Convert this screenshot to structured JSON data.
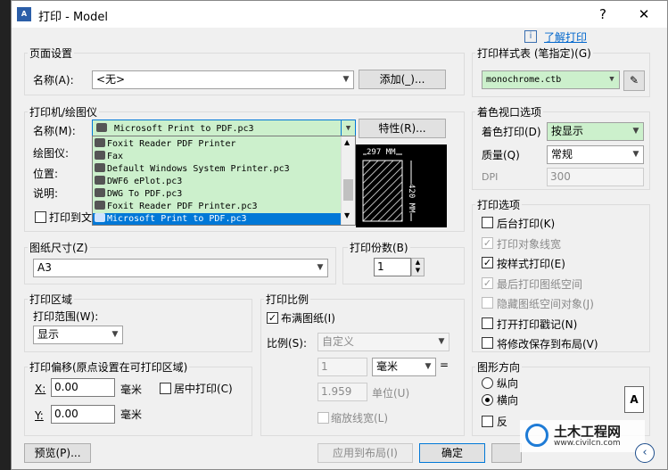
{
  "window": {
    "title": "打印 - Model",
    "help_btn": "?",
    "close_btn": "✕",
    "info_link": "了解打印"
  },
  "page_setup": {
    "group": "页面设置",
    "name_label": "名称(A):",
    "name_value": "<无>",
    "add_btn": "添加(_)..."
  },
  "printer": {
    "group": "打印机/绘图仪",
    "name_label": "名称(M):",
    "selected": "Microsoft Print to PDF.pc3",
    "props_btn": "特性(R)...",
    "plotter_label": "绘图仪:",
    "location_label": "位置:",
    "desc_label": "说明:",
    "print_to_file": "打印到文",
    "list": [
      "Foxit Reader PDF Printer",
      "Fax",
      "Default Windows System Printer.pc3",
      "DWF6 ePlot.pc3",
      "DWG To PDF.pc3",
      "Foxit Reader PDF Printer.pc3",
      "Microsoft Print to PDF.pc3"
    ],
    "preview_width": "297 MM",
    "preview_height": "420 MM"
  },
  "paper": {
    "group": "图纸尺寸(Z)",
    "value": "A3"
  },
  "copies": {
    "group": "打印份数(B)",
    "value": "1"
  },
  "area": {
    "group": "打印区域",
    "range_label": "打印范围(W):",
    "range_value": "显示"
  },
  "offset": {
    "group": "打印偏移(原点设置在可打印区域)",
    "x_label": "X:",
    "x_value": "0.00",
    "y_label": "Y:",
    "y_value": "0.00",
    "unit_mm": "毫米",
    "center": "居中打印(C)"
  },
  "scale": {
    "group": "打印比例",
    "fit": "布满图纸(I)",
    "scale_label": "比例(S):",
    "scale_value": "自定义",
    "v1": "1",
    "v1_unit": "毫米",
    "v2": "1.959",
    "v2_unit": "单位(U)",
    "scale_lw": "缩放线宽(L)",
    "eq": "="
  },
  "style_table": {
    "group": "打印样式表 (笔指定)(G)",
    "value": "monochrome.ctb"
  },
  "shaded": {
    "group": "着色视口选项",
    "shade_label": "着色打印(D)",
    "shade_value": "按显示",
    "quality_label": "质量(Q)",
    "quality_value": "常规",
    "dpi_label": "DPI",
    "dpi_value": "300"
  },
  "options": {
    "group": "打印选项",
    "items": [
      {
        "label": "后台打印(K)",
        "checked": false,
        "disabled": false
      },
      {
        "label": "打印对象线宽",
        "checked": true,
        "disabled": true
      },
      {
        "label": "按样式打印(E)",
        "checked": true,
        "disabled": false
      },
      {
        "label": "最后打印图纸空间",
        "checked": true,
        "disabled": true
      },
      {
        "label": "隐藏图纸空间对象(J)",
        "checked": false,
        "disabled": true
      },
      {
        "label": "打开打印戳记(N)",
        "checked": false,
        "disabled": false
      },
      {
        "label": "将修改保存到布局(V)",
        "checked": false,
        "disabled": false
      }
    ]
  },
  "orientation": {
    "group": "图形方向",
    "portrait": "纵向",
    "landscape": "横向",
    "reverse": "反"
  },
  "footer": {
    "preview_btn": "预览(P)...",
    "apply_btn": "应用到布局(I)",
    "ok_btn": "确定"
  },
  "watermark": {
    "title": "土木工程网",
    "url": "www.civilcn.com"
  }
}
